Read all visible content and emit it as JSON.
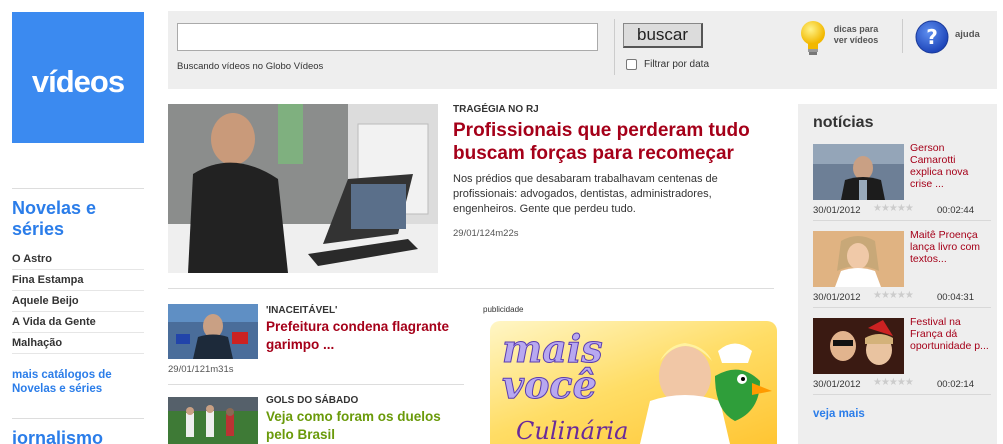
{
  "sidebar": {
    "logo": "vídeos",
    "section1_title": "Novelas e séries",
    "items": [
      {
        "label": "O Astro"
      },
      {
        "label": "Fina Estampa"
      },
      {
        "label": "Aquele Beijo"
      },
      {
        "label": "A Vida da Gente"
      },
      {
        "label": "Malhação"
      }
    ],
    "more_catalogs": "mais catálogos de Novelas e séries",
    "section2_title": "jornalismo"
  },
  "search": {
    "value": "",
    "placeholder": "",
    "hint": "Buscando vídeos no Globo Vídeos",
    "button": "buscar",
    "filter_label": "Filtrar por data",
    "tips": "dicas para ver vídeos",
    "help": "ajuda"
  },
  "featured": {
    "kicker": "TRAGÉGIA NO RJ",
    "title": "Profissionais que perderam tudo buscam forças para recomeçar",
    "description": "Nos prédios que desabaram trabalhavam centenas de profissionais: advogados, dentistas, administradores, engenheiros. Gente que perdeu tudo.",
    "date": "29/01/124m22s"
  },
  "stories": [
    {
      "kicker": "'INACEITÁVEL'",
      "title": "Prefeitura condena flagrante garimpo ...",
      "date": "29/01/121m31s",
      "color": "#a50019"
    },
    {
      "kicker": "GOLS DO SÁBADO",
      "title": "Veja como foram os duelos pelo Brasil",
      "color": "#6a9a0a"
    }
  ],
  "ad": {
    "label": "publicidade",
    "brand": "mais você",
    "subtitle": "Culinária"
  },
  "news": {
    "heading": "notícias",
    "items": [
      {
        "title": "Gerson Camarotti explica nova crise ...",
        "date": "30/01/2012",
        "rating": 0,
        "duration": "00:02:44"
      },
      {
        "title": "Maitê Proença lança livro com textos...",
        "date": "30/01/2012",
        "rating": 0,
        "duration": "00:04:31"
      },
      {
        "title": "Festival na França dá oportunidade p...",
        "date": "30/01/2012",
        "rating": 0,
        "duration": "00:02:14"
      }
    ],
    "more": "veja mais"
  },
  "colors": {
    "accent_blue": "#2b7de9",
    "headline_red": "#a50019",
    "headline_green": "#6a9a0a"
  }
}
